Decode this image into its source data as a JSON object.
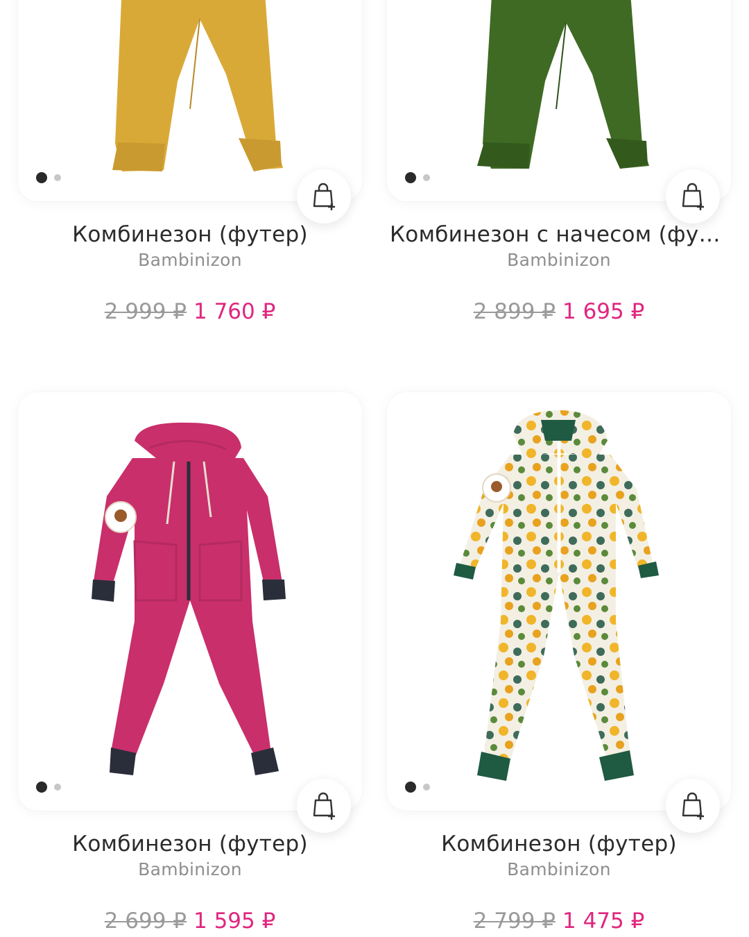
{
  "products": [
    {
      "title": "Комбинезон (футер)",
      "brand": "Bambinizon",
      "old_price": "2 999 ₽",
      "new_price": "1 760 ₽",
      "garment": "mustard-pants",
      "color": "#d9a938"
    },
    {
      "title": "Комбинезон с начесом (фут…",
      "brand": "Bambinizon",
      "old_price": "2 899 ₽",
      "new_price": "1 695 ₽",
      "garment": "green-pants",
      "color": "#3f6a24"
    },
    {
      "title": "Комбинезон (футер)",
      "brand": "Bambinizon",
      "old_price": "2 699 ₽",
      "new_price": "1 595 ₽",
      "garment": "pink-jumpsuit",
      "color": "#c92f6b"
    },
    {
      "title": "Комбинезон (футер)",
      "brand": "Bambinizon",
      "old_price": "2 799 ₽",
      "new_price": "1 475 ₽",
      "garment": "floral-jumpsuit",
      "color": "#f0b52a"
    }
  ],
  "icons": {
    "cart": "shopping-bag-plus-icon"
  },
  "colors": {
    "sale_price": "#e0267e",
    "old_price": "#9a9a9a"
  }
}
